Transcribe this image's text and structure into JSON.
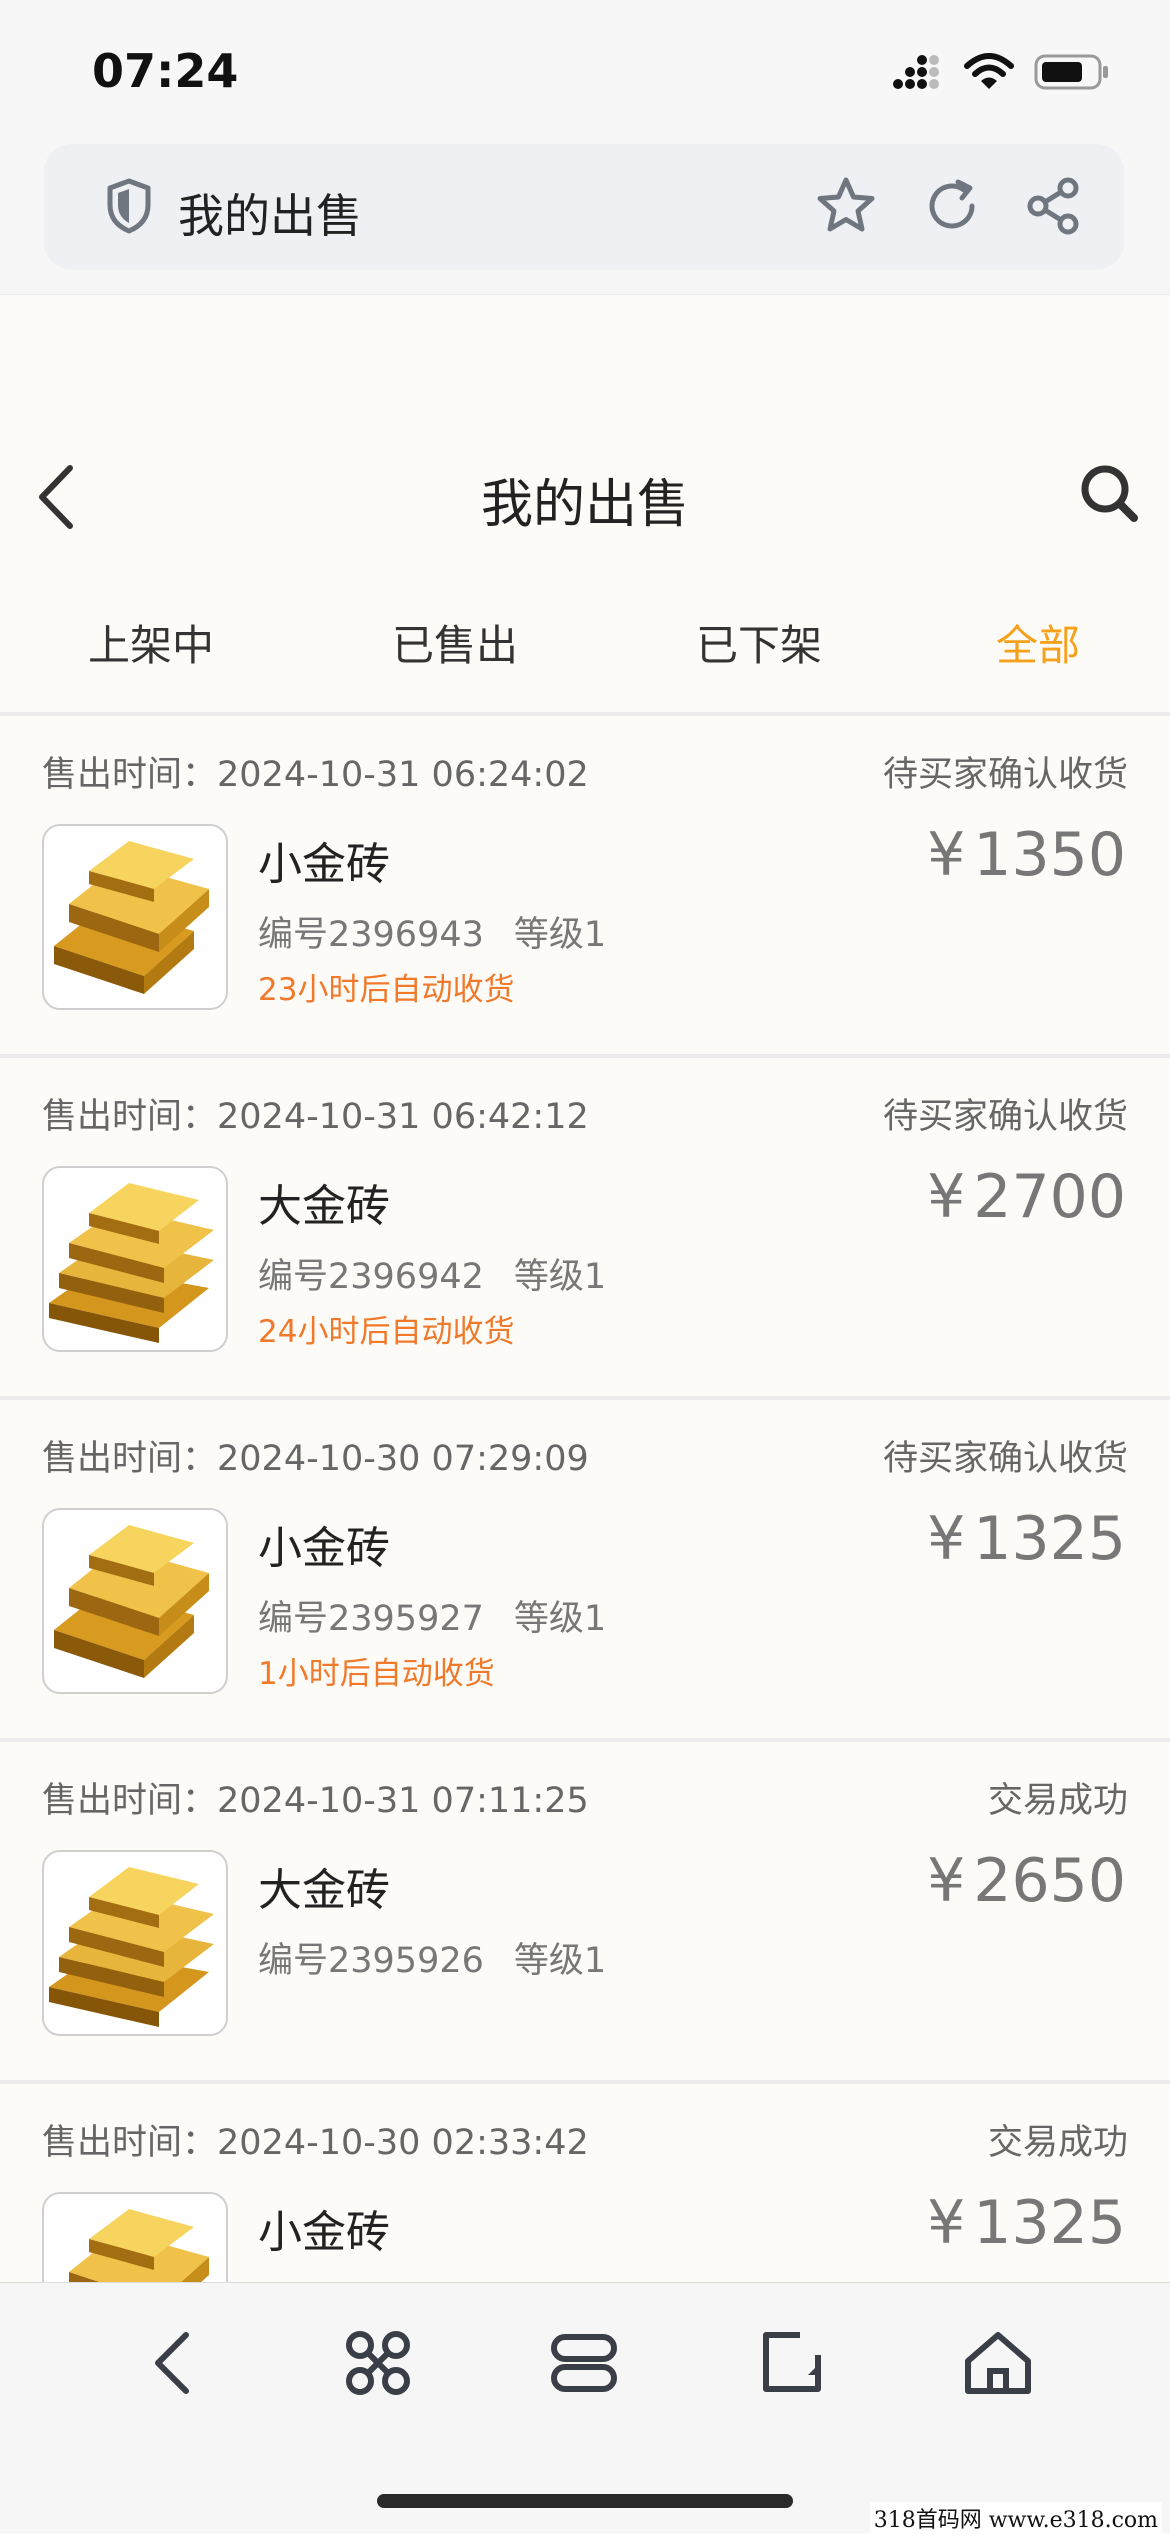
{
  "status_bar": {
    "time": "07:24"
  },
  "browser": {
    "title": "我的出售"
  },
  "header": {
    "title": "我的出售"
  },
  "tabs": [
    {
      "label": "上架中",
      "active": false
    },
    {
      "label": "已售出",
      "active": false
    },
    {
      "label": "已下架",
      "active": false
    },
    {
      "label": "全部",
      "active": true
    }
  ],
  "colors": {
    "accent": "#f5a11c",
    "note": "#f0792a",
    "price": "#777777"
  },
  "orders": [
    {
      "time_label": "售出时间：",
      "time": "2024-10-31 06:24:02",
      "status": "待买家确认收货",
      "name": "小金砖",
      "serial": "编号2396943",
      "level": "等级1",
      "note": "23小时后自动收货",
      "currency": "¥",
      "price": "1350",
      "icon": "small-gold-bar-icon"
    },
    {
      "time_label": "售出时间：",
      "time": "2024-10-31 06:42:12",
      "status": "待买家确认收货",
      "name": "大金砖",
      "serial": "编号2396942",
      "level": "等级1",
      "note": "24小时后自动收货",
      "currency": "¥",
      "price": "2700",
      "icon": "large-gold-bar-icon"
    },
    {
      "time_label": "售出时间：",
      "time": "2024-10-30 07:29:09",
      "status": "待买家确认收货",
      "name": "小金砖",
      "serial": "编号2395927",
      "level": "等级1",
      "note": "1小时后自动收货",
      "currency": "¥",
      "price": "1325",
      "icon": "small-gold-bar-icon"
    },
    {
      "time_label": "售出时间：",
      "time": "2024-10-31 07:11:25",
      "status": "交易成功",
      "name": "大金砖",
      "serial": "编号2395926",
      "level": "等级1",
      "note": "",
      "currency": "¥",
      "price": "2650",
      "icon": "large-gold-bar-icon"
    },
    {
      "time_label": "售出时间：",
      "time": "2024-10-30 02:33:42",
      "status": "交易成功",
      "name": "小金砖",
      "serial": "",
      "level": "",
      "note": "",
      "currency": "¥",
      "price": "1325",
      "icon": "small-gold-bar-icon"
    }
  ],
  "bottom_nav": {
    "icons": [
      "back-arrow-icon",
      "command-icon",
      "tabs-icon",
      "edit-page-icon",
      "home-icon"
    ]
  },
  "watermark": "318首码网  www.e318.com"
}
